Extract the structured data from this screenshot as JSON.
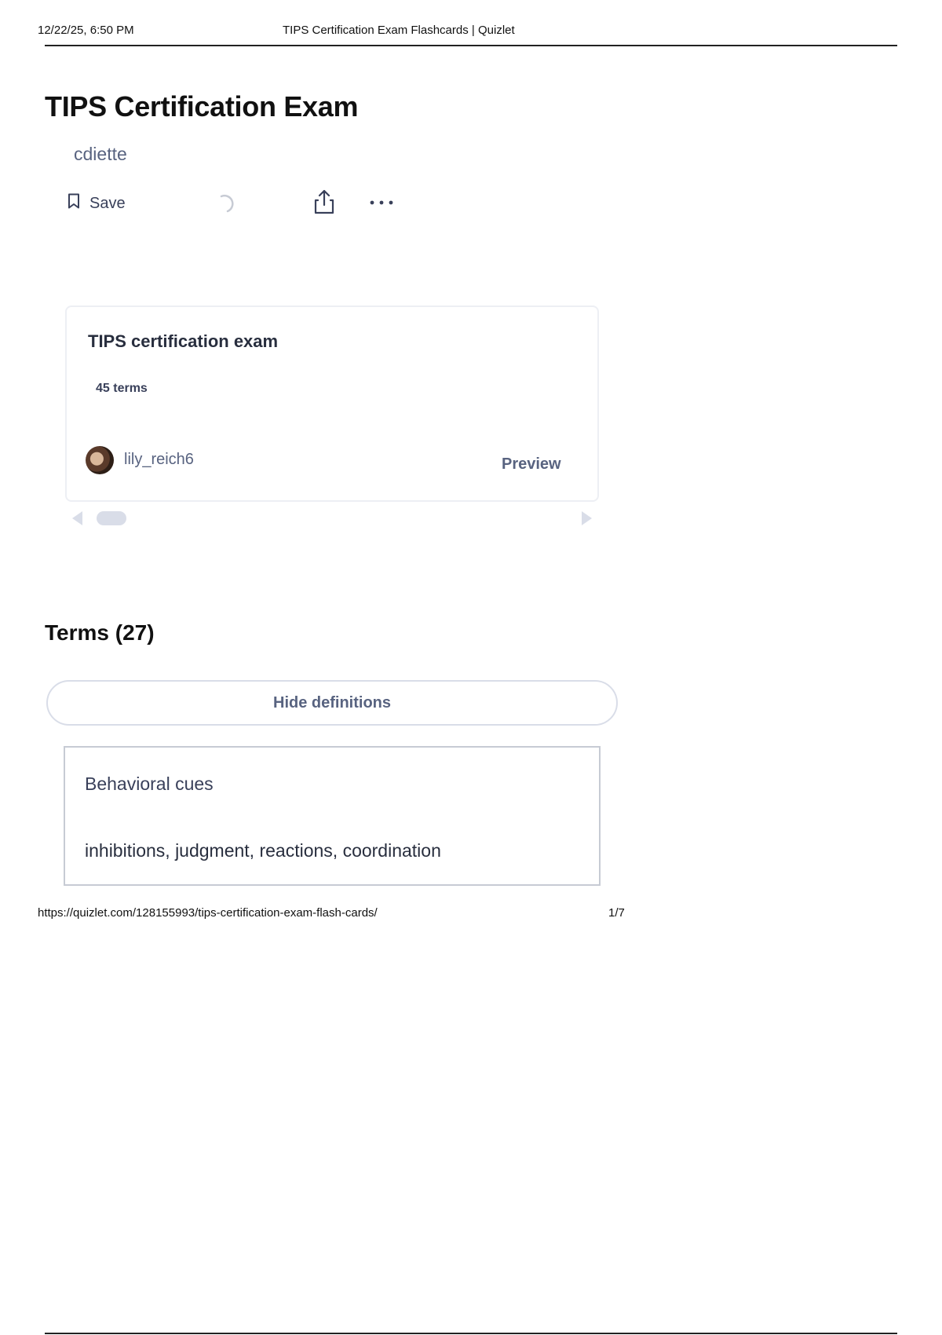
{
  "print_header": {
    "datetime": "12/22/25, 6:50 PM",
    "page_title": "TIPS Certification Exam Flashcards | Quizlet"
  },
  "set": {
    "title": "TIPS Certification Exam",
    "author": "cdiette"
  },
  "actions": {
    "save_label": "Save",
    "icons": [
      "bookmark-icon",
      "loading-spinner-icon",
      "share-icon",
      "more-options-icon"
    ]
  },
  "related_card": {
    "title": "TIPS certification exam",
    "term_count": "45 terms",
    "username": "lily_reich6",
    "preview_label": "Preview"
  },
  "terms_section": {
    "heading": "Terms (27)",
    "hide_definitions_label": "Hide definitions",
    "items": [
      {
        "term": "Behavioral cues",
        "definition": "inhibitions, judgment, reactions, coordination"
      }
    ]
  },
  "print_footer": {
    "url": "https://quizlet.com/128155993/tips-certification-exam-flash-cards/",
    "page_number": "1/7"
  },
  "colors": {
    "text_primary": "#282e3e",
    "text_secondary": "#586380",
    "border_light": "#edeff4",
    "border_gray": "#c7cbd4",
    "scroll_control": "#d9dde8"
  }
}
